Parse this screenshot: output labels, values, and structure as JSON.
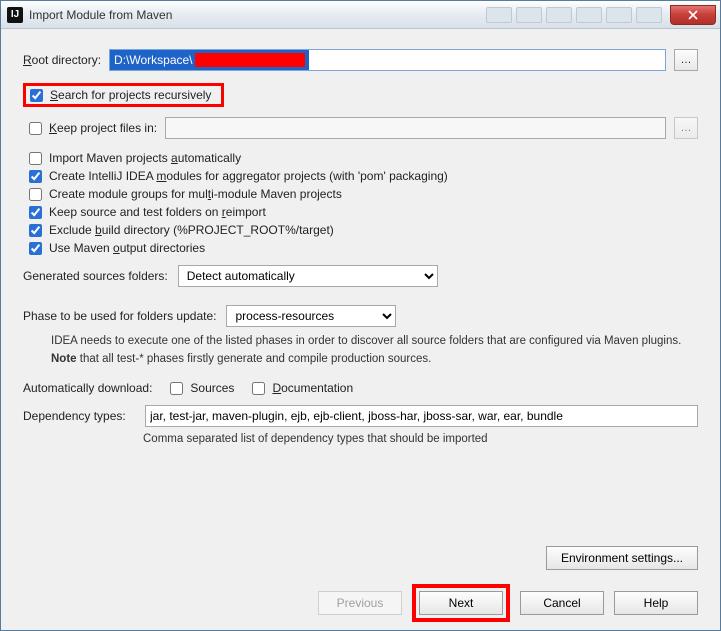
{
  "titlebar": {
    "title": "Import Module from Maven"
  },
  "rootdir": {
    "label_pre": "R",
    "label_rest": "oot directory:",
    "path_prefix": "D:\\Workspace\\"
  },
  "search": {
    "label_pre": "S",
    "label_rest": "earch for projects recursively"
  },
  "keep": {
    "label_pre": "K",
    "label_rest": "eep project files in:",
    "value": ""
  },
  "options": {
    "import_auto": {
      "pre": "Import Maven projects ",
      "u": "a",
      "rest": "utomatically"
    },
    "create_agg": {
      "pre": "Create IntelliJ IDEA ",
      "u": "m",
      "rest": "odules for aggregator projects (with 'pom' packaging)"
    },
    "create_grp": {
      "pre": "Create module groups for mul",
      "u": "t",
      "rest": "i-module Maven projects"
    },
    "keep_src": {
      "pre": "Keep source and test folders on ",
      "u": "r",
      "rest": "eimport"
    },
    "exclude": {
      "pre": "Exclude ",
      "u": "b",
      "rest": "uild directory (%PROJECT_ROOT%/target)"
    },
    "use_out": {
      "pre": "Use Maven ",
      "u": "o",
      "rest": "utput directories"
    }
  },
  "generated": {
    "label": "Generated sources folders:",
    "value": "Detect automatically"
  },
  "phase": {
    "label": "Phase to be used for folders update:",
    "value": "process-resources",
    "note1": "IDEA needs to execute one of the listed phases in order to discover all source folders that are configured via Maven plugins.",
    "note2_pre": "Note",
    "note2_rest": " that all test-* phases firstly generate and compile production sources."
  },
  "auto": {
    "label": "Automatically download:",
    "sources": "Sources",
    "docs": "Documentation"
  },
  "dep": {
    "label": "Dependency types:",
    "value": "jar, test-jar, maven-plugin, ejb, ejb-client, jboss-har, jboss-sar, war, ear, bundle",
    "note": "Comma separated list of dependency types that should be imported"
  },
  "buttons": {
    "env": "Environment settings...",
    "prev": "Previous",
    "next": "Next",
    "cancel": "Cancel",
    "help": "Help"
  }
}
